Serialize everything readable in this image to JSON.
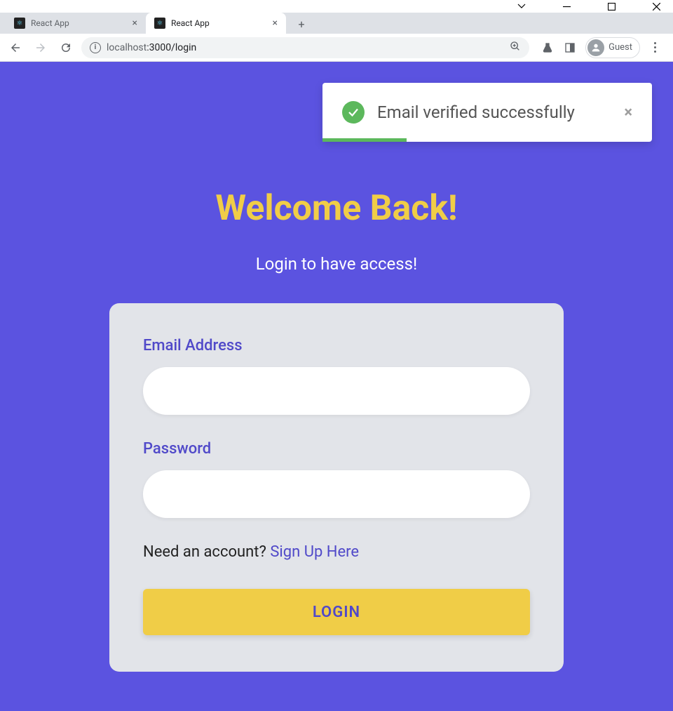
{
  "window": {
    "tabs": [
      {
        "title": "React App",
        "active": false
      },
      {
        "title": "React App",
        "active": true
      }
    ]
  },
  "toolbar": {
    "url_host": "localhost",
    "url_port_path": ":3000/login",
    "profile_label": "Guest"
  },
  "toast": {
    "message": "Email verified successfully"
  },
  "page": {
    "title": "Welcome Back!",
    "subtitle": "Login to have access!"
  },
  "form": {
    "email_label": "Email Address",
    "email_value": "",
    "password_label": "Password",
    "password_value": "",
    "signup_prompt": "Need an account? ",
    "signup_link": "Sign Up Here",
    "login_button": "LOGIN"
  }
}
